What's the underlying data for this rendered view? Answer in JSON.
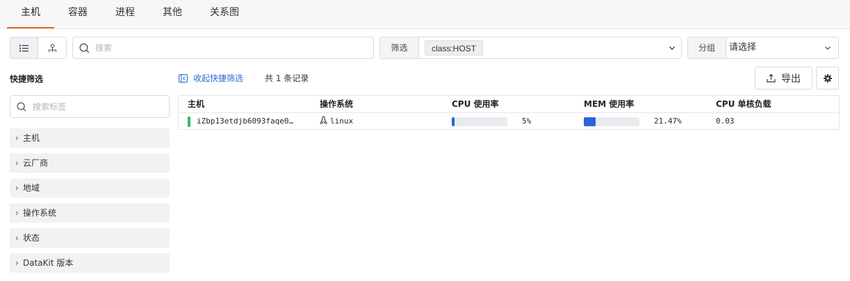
{
  "tabs": [
    {
      "label": "主机",
      "active": true
    },
    {
      "label": "容器",
      "active": false
    },
    {
      "label": "进程",
      "active": false
    },
    {
      "label": "其他",
      "active": false
    },
    {
      "label": "关系图",
      "active": false
    }
  ],
  "view_toggle": {
    "list_icon": "list-icon",
    "topology_icon": "topology-icon"
  },
  "search": {
    "placeholder": "搜索",
    "icon": "search-icon"
  },
  "filter": {
    "label": "筛选",
    "chip": "class:HOST"
  },
  "group": {
    "label": "分组",
    "value": "请选择"
  },
  "quick_filter": {
    "title": "快捷筛选",
    "search_placeholder": "搜索标签",
    "facets": [
      "主机",
      "云厂商",
      "地域",
      "操作系统",
      "状态",
      "DataKit 版本"
    ]
  },
  "toolbar": {
    "collapse_label": "收起快捷筛选",
    "record_count": "共 1 条记录",
    "export_label": "导出"
  },
  "table": {
    "columns": [
      "主机",
      "操作系统",
      "CPU 使用率",
      "MEM 使用率",
      "CPU 单核负载"
    ],
    "rows": [
      {
        "host": "iZbp13etdjb6093faqe0…",
        "os": "linux",
        "cpu_text": "5%",
        "cpu_value": 0.05,
        "mem_text": "21.47%",
        "mem_value": 0.2147,
        "load": "0.03"
      }
    ]
  },
  "colors": {
    "accent": "#e8612c",
    "link": "#2c6bd6",
    "bar_fill": "#2a64d8",
    "status_ok": "#2fc25b"
  }
}
